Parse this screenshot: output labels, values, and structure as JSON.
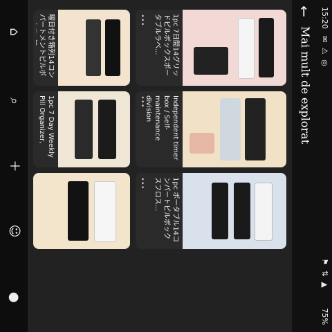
{
  "status": {
    "time": "15:20",
    "battery": "75%"
  },
  "header": {
    "title": "Mai mult de explorat"
  },
  "cards": [
    {
      "caption": "1pc 7日間14グリッドピルボックスポータブルラベ...",
      "bg": "#f2d9d6",
      "accent": "#1a1a1a"
    },
    {
      "caption": "Independent timer box / Self-maintenance division",
      "bg": "#f1e2c7",
      "accent": "#222"
    },
    {
      "caption": "1pc ポータブル14コンパートピルボックスフロス...",
      "bg": "#d8e1ec",
      "accent": "#eee"
    },
    {
      "caption": "曜日付き箱列14コンパートメントピルボックス1個...",
      "bg": "#f4e3cf",
      "accent": "#111"
    },
    {
      "caption": "1pc 7 Day Weekly Pill Organizer, Large Am Pm ...",
      "bg": "#efe6d6",
      "accent": "#1b1b1b"
    },
    {
      "caption": "",
      "bg": "#f3e4cc",
      "accent": "#eee"
    }
  ],
  "colors": {
    "bar": "#111111",
    "surface": "#222222",
    "text": "#ffffff"
  },
  "icons": [
    "back-arrow-icon",
    "home-icon",
    "search-icon",
    "add-icon",
    "chat-icon",
    "profile-icon",
    "menu-icon",
    "circle-icon",
    "chevron-icon"
  ]
}
